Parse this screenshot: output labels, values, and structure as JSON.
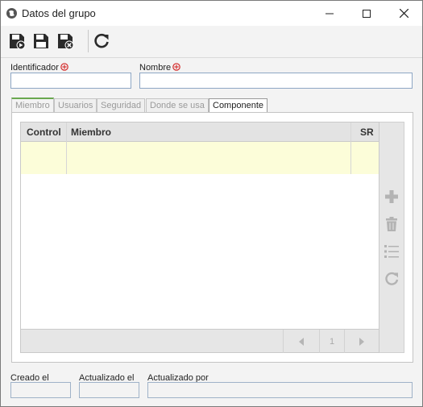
{
  "window": {
    "title": "Datos del grupo",
    "app_icon": "globe-icon",
    "controls": [
      "minimize-icon",
      "maximize-icon",
      "close-icon"
    ]
  },
  "toolbar": {
    "buttons": [
      "save-new-icon",
      "save-icon",
      "save-close-icon",
      "refresh-icon"
    ]
  },
  "form": {
    "identificador_label": "Identificador",
    "identificador_value": "",
    "nombre_label": "Nombre",
    "nombre_value": ""
  },
  "tabs": [
    {
      "label": "Miembro",
      "active": true
    },
    {
      "label": "Usuarios"
    },
    {
      "label": "Seguridad"
    },
    {
      "label": "Donde se usa"
    },
    {
      "label": "Componente"
    }
  ],
  "grid": {
    "columns": [
      "Control",
      "Miembro",
      "SR"
    ],
    "rows": [
      [
        "",
        "",
        ""
      ]
    ],
    "page": "1",
    "highlight_color": "#fcfdd9"
  },
  "side_actions": [
    "add-icon",
    "delete-icon",
    "list-icon",
    "refresh-icon"
  ],
  "footer": {
    "creado_label": "Creado el",
    "creado_value": "",
    "actualizado_label": "Actualizado el",
    "actualizado_value": "",
    "actualizado_por_label": "Actualizado por",
    "actualizado_por_value": ""
  },
  "colors": {
    "required": "#d42a2a",
    "active_tab": "#6aa84f"
  }
}
